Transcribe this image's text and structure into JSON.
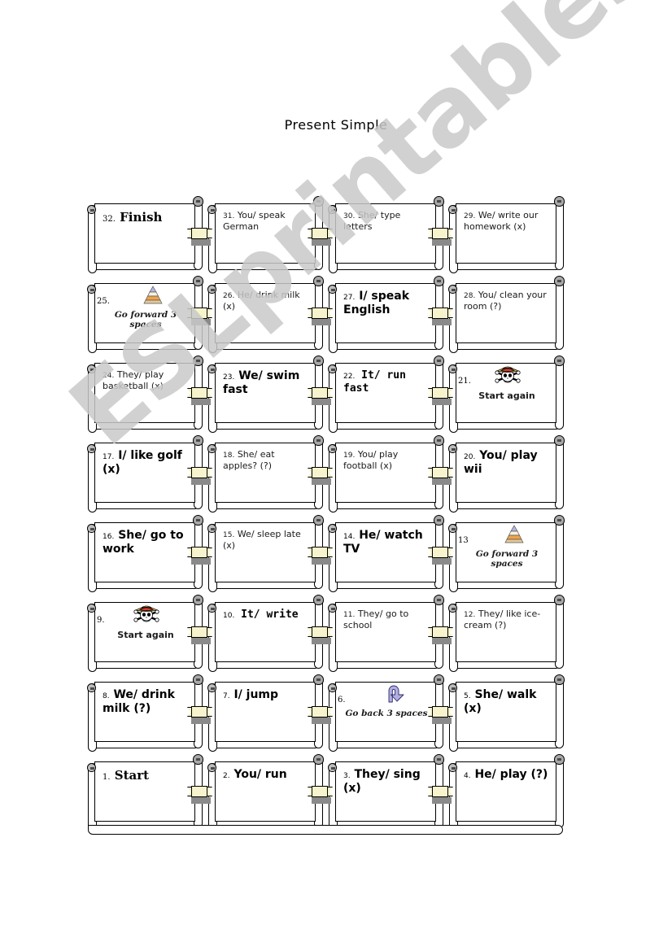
{
  "page": {
    "title": "Present Simple",
    "watermark": "ESLprintables.com"
  },
  "colors": {
    "card_fill": "#ffffff",
    "card_border": "#000000",
    "clasp_fill": "#f7f4cd",
    "cap_grey": "#b0b0b0",
    "shadow_grey": "#8a8a8a",
    "watermark_grey": "#c9c9c9",
    "pyramid_top": "#b9b4e0",
    "pyramid_mid": "#f6f2e2",
    "pyramid_orange": "#f0a24a",
    "pyramid_base": "#e3c89a",
    "hat_straw": "#f2c14b",
    "hat_band": "#d83a2e",
    "arrow_purple": "#b3aee0"
  },
  "board": {
    "rows": [
      {
        "row": 1,
        "cells": [
          {
            "number": "32.",
            "text": "Finish",
            "style": "serif",
            "special": null,
            "icon": null
          },
          {
            "number": "31.",
            "text": "You/ speak German",
            "style": "light",
            "special": null,
            "icon": null
          },
          {
            "number": "30.",
            "text": "She/ type letters",
            "style": "light",
            "special": null,
            "icon": null
          },
          {
            "number": "29.",
            "text": "We/ write our homework (x)",
            "style": "light",
            "special": null,
            "icon": null
          }
        ]
      },
      {
        "row": 2,
        "cells": [
          {
            "number": "25.",
            "text": "Go forward 3 spaces",
            "style": "light",
            "special": "pyramid",
            "icon": "pyramid-icon"
          },
          {
            "number": "26.",
            "text": "He/ drink milk (x)",
            "style": "light",
            "special": null,
            "icon": null
          },
          {
            "number": "27.",
            "text": "I/ speak English",
            "style": "bold",
            "special": null,
            "icon": null
          },
          {
            "number": "28.",
            "text": "You/ clean your room (?)",
            "style": "light",
            "special": null,
            "icon": null
          }
        ]
      },
      {
        "row": 3,
        "cells": [
          {
            "number": "24.",
            "text": "They/ play basketball (x)",
            "style": "light",
            "special": null,
            "icon": null
          },
          {
            "number": "23.",
            "text": "We/ swim fast",
            "style": "bold",
            "special": null,
            "icon": null
          },
          {
            "number": "22.",
            "text": "It/ run fast",
            "style": "mono",
            "special": null,
            "icon": null
          },
          {
            "number": "21.",
            "text": "Start again",
            "style": "light",
            "special": "skull",
            "icon": "pirate-skull-icon"
          }
        ]
      },
      {
        "row": 4,
        "cells": [
          {
            "number": "17.",
            "text": "I/ like golf (x)",
            "style": "bold",
            "special": null,
            "icon": null
          },
          {
            "number": "18.",
            "text": "She/ eat apples? (?)",
            "style": "light",
            "special": null,
            "icon": null
          },
          {
            "number": "19.",
            "text": "You/ play football (x)",
            "style": "light",
            "special": null,
            "icon": null
          },
          {
            "number": "20.",
            "text": "You/ play wii",
            "style": "bold",
            "special": null,
            "icon": null
          }
        ]
      },
      {
        "row": 5,
        "cells": [
          {
            "number": "16.",
            "text": "She/ go to work",
            "style": "bold",
            "special": null,
            "icon": null
          },
          {
            "number": "15.",
            "text": "We/ sleep late (x)",
            "style": "light",
            "special": null,
            "icon": null
          },
          {
            "number": "14.",
            "text": "He/ watch TV",
            "style": "bold",
            "special": null,
            "icon": null
          },
          {
            "number": "13",
            "text": "Go forward 3 spaces",
            "style": "light",
            "special": "pyramid",
            "icon": "pyramid-icon"
          }
        ]
      },
      {
        "row": 6,
        "cells": [
          {
            "number": "9.",
            "text": "Start again",
            "style": "light",
            "special": "skull",
            "icon": "pirate-skull-icon"
          },
          {
            "number": "10.",
            "text": "It/ write",
            "style": "mono",
            "special": null,
            "icon": null
          },
          {
            "number": "11.",
            "text": "They/ go to school",
            "style": "light",
            "special": null,
            "icon": null
          },
          {
            "number": "12.",
            "text": "They/ like ice-cream (?)",
            "style": "light",
            "special": null,
            "icon": null
          }
        ]
      },
      {
        "row": 7,
        "cells": [
          {
            "number": "8.",
            "text": "We/ drink milk (?)",
            "style": "bold",
            "special": null,
            "icon": null
          },
          {
            "number": "7.",
            "text": "I/ jump",
            "style": "bold",
            "special": null,
            "icon": null
          },
          {
            "number": "6.",
            "text": "Go back 3 spaces",
            "style": "light",
            "special": "uturn",
            "icon": "u-turn-arrow-icon"
          },
          {
            "number": "5.",
            "text": "She/ walk (x)",
            "style": "bold",
            "special": null,
            "icon": null
          }
        ]
      },
      {
        "row": 8,
        "cells": [
          {
            "number": "1.",
            "text": "Start",
            "style": "serif",
            "special": null,
            "icon": null
          },
          {
            "number": "2.",
            "text": "You/ run",
            "style": "bold",
            "special": null,
            "icon": null
          },
          {
            "number": "3.",
            "text": "They/ sing (x)",
            "style": "bold",
            "special": null,
            "icon": null
          },
          {
            "number": "4.",
            "text": "He/ play (?)",
            "style": "bold",
            "special": null,
            "icon": null
          }
        ]
      }
    ]
  }
}
